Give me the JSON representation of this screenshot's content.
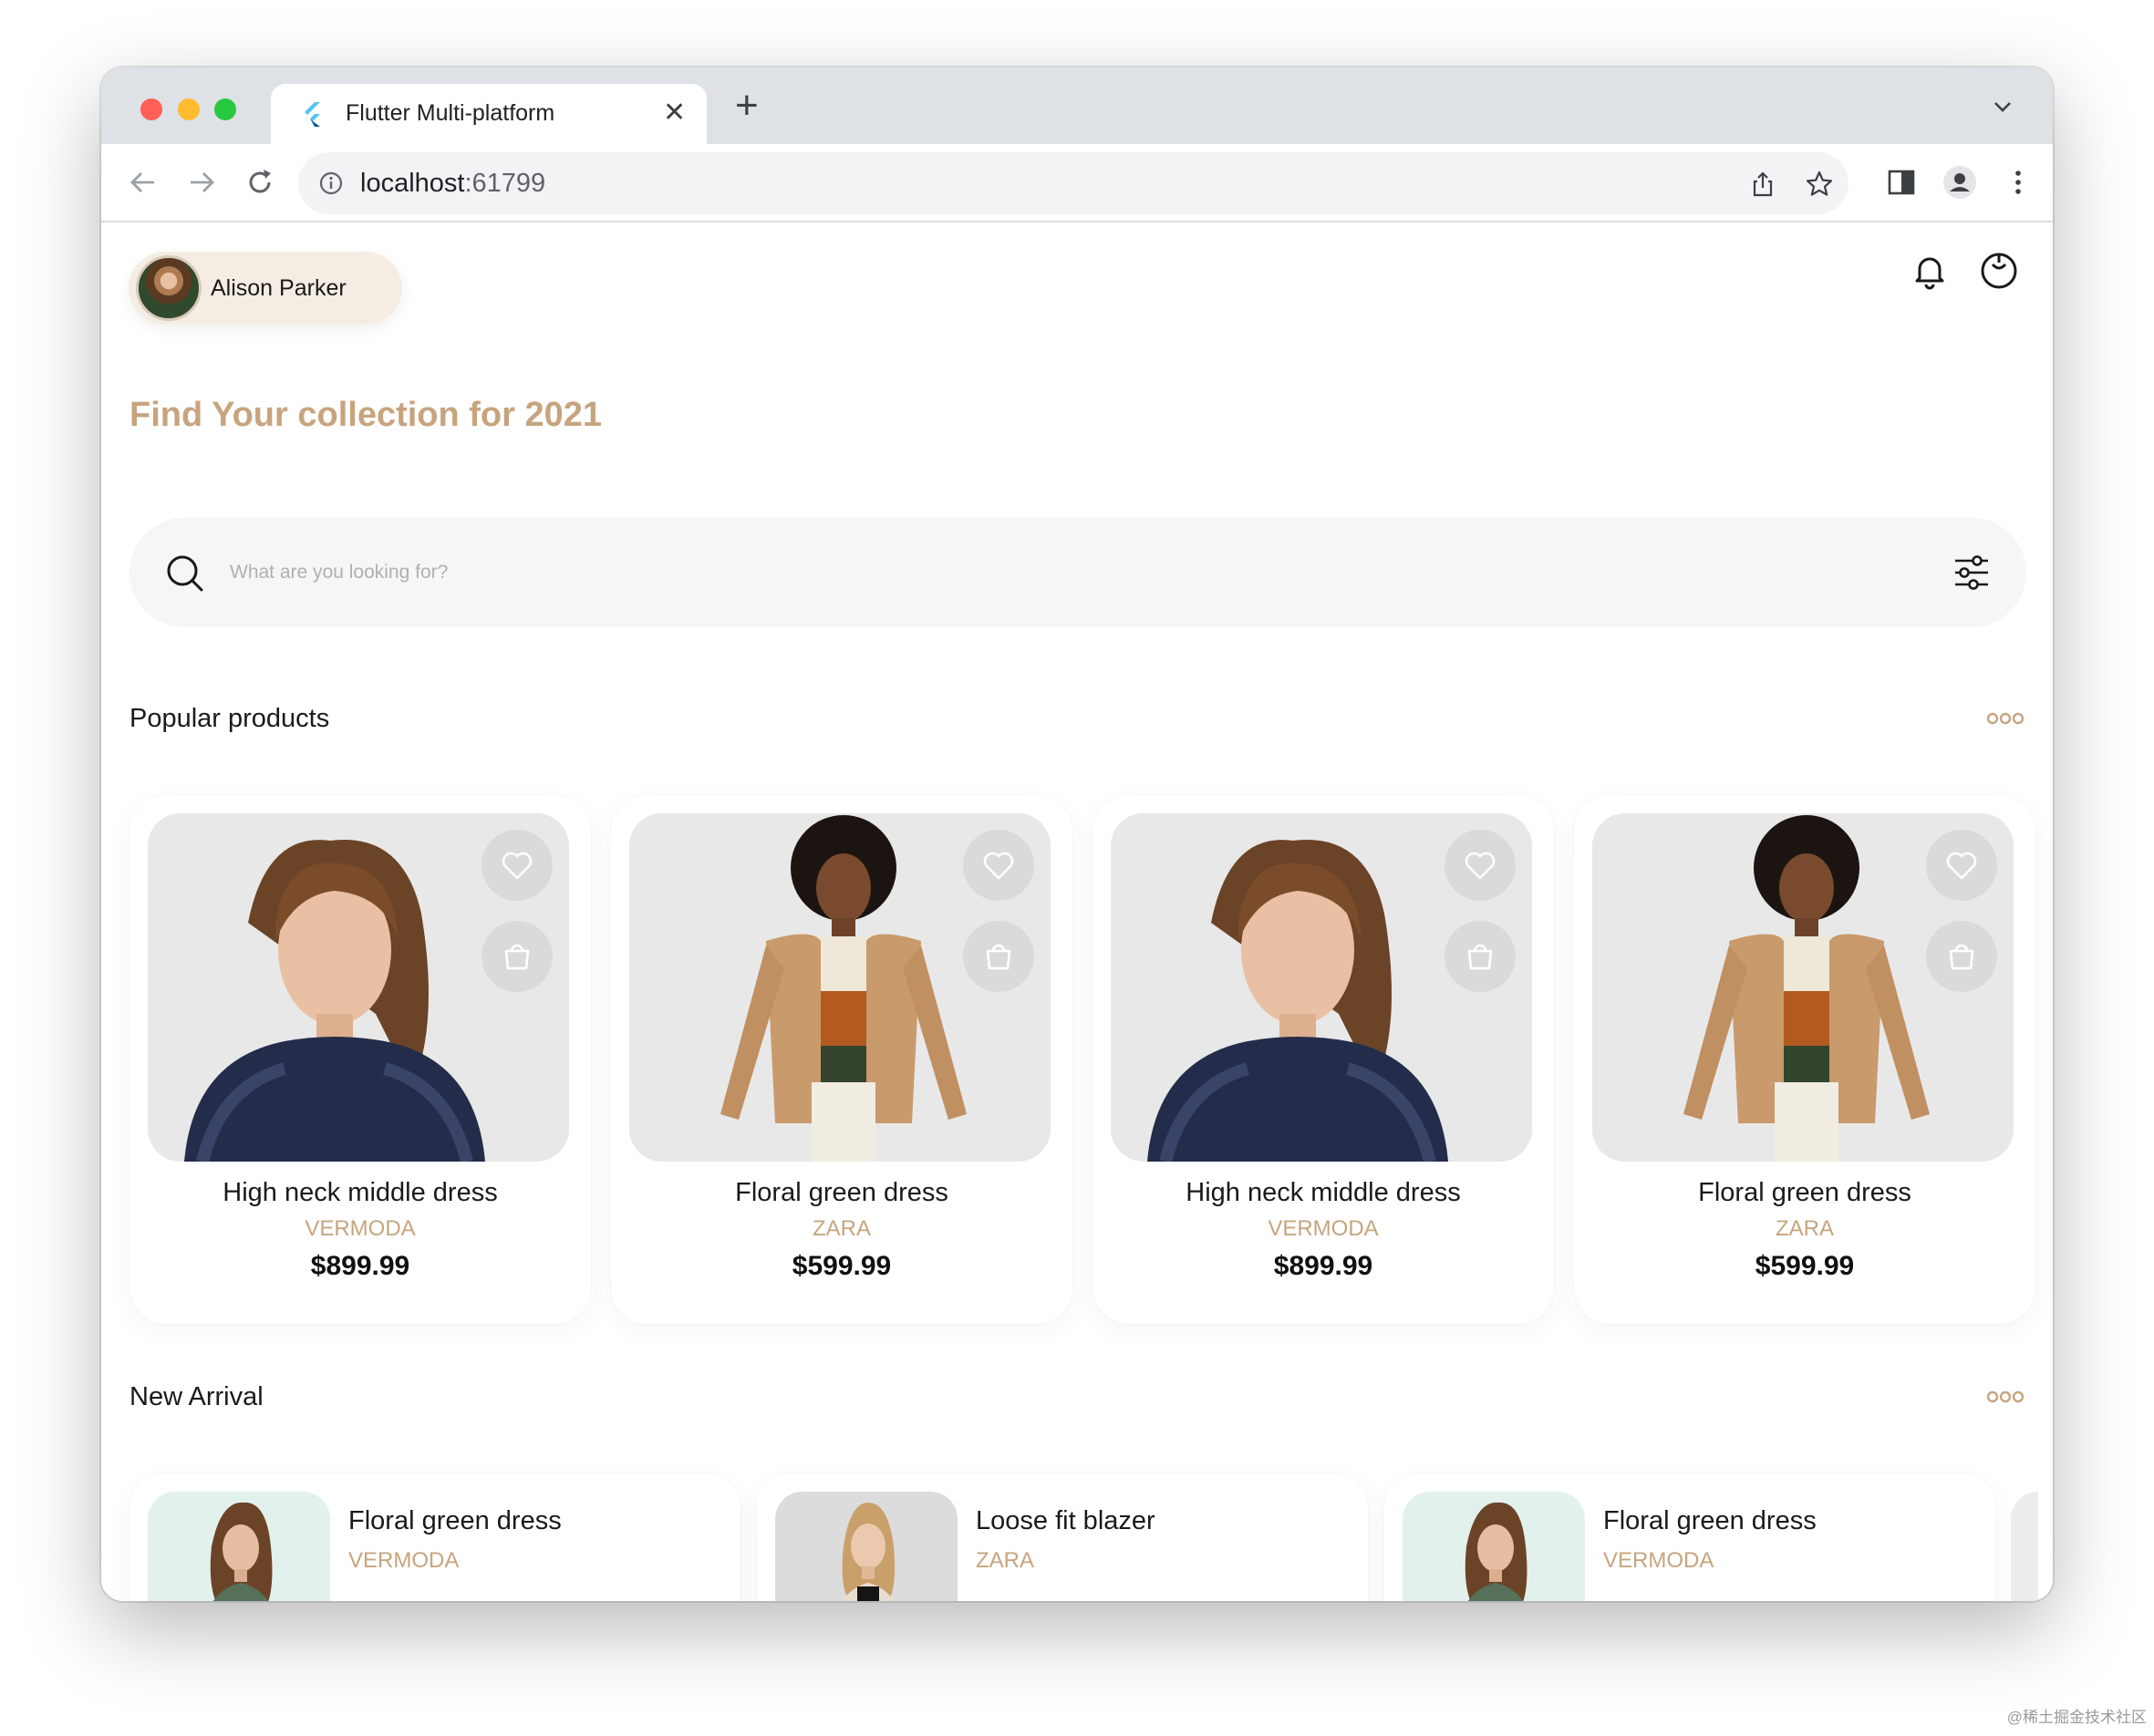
{
  "browser": {
    "tab_title": "Flutter Multi-platform",
    "tab_close": "✕",
    "new_tab": "+",
    "url_host": "localhost",
    "url_port": ":61799"
  },
  "header": {
    "user_name": "Alison Parker",
    "headline": "Find Your collection for 2021"
  },
  "search": {
    "placeholder": "What are you looking for?"
  },
  "popular": {
    "title": "Popular products",
    "products": [
      {
        "name": "High neck middle dress",
        "brand": "VERMODA",
        "price": "$899.99",
        "image": "woman-navy-top"
      },
      {
        "name": "Floral green dress",
        "brand": "ZARA",
        "price": "$599.99",
        "image": "woman-camel-blazer"
      },
      {
        "name": "High neck middle dress",
        "brand": "VERMODA",
        "price": "$899.99",
        "image": "woman-navy-top"
      },
      {
        "name": "Floral green dress",
        "brand": "ZARA",
        "price": "$599.99",
        "image": "woman-camel-blazer"
      }
    ]
  },
  "arrivals": {
    "title": "New Arrival",
    "items": [
      {
        "name": "Floral green dress",
        "brand": "VERMODA",
        "image": "woman-green-floral"
      },
      {
        "name": "Loose fit blazer",
        "brand": "ZARA",
        "image": "woman-beige-blazer"
      },
      {
        "name": "Floral green dress",
        "brand": "VERMODA",
        "image": "woman-green-floral"
      }
    ]
  },
  "colors": {
    "accent": "#c7a47e",
    "chip_bg": "#f5ede4",
    "search_bg": "#f6f6f6"
  },
  "watermark": "@稀土掘金技术社区"
}
